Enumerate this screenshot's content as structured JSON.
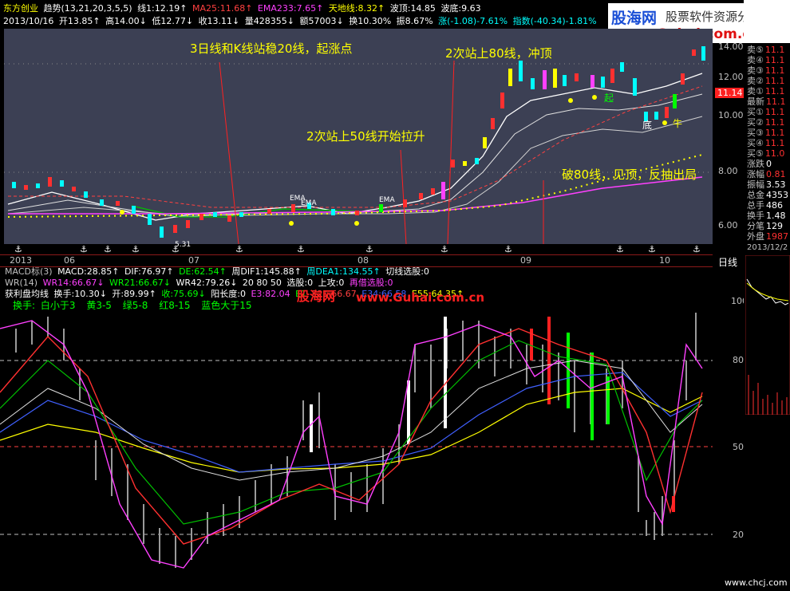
{
  "top_bar": {
    "stock_name": "东方创业",
    "indicator": "趋势(13,21,20,3,5,5)",
    "ma_items": [
      {
        "text": "线1:12.19↑",
        "color": "#ffffff"
      },
      {
        "text": "MA25:11.68↑",
        "color": "#ff4040"
      },
      {
        "text": "EMA233:7.65↑",
        "color": "#ff40ff"
      },
      {
        "text": "天地线:8.32↑",
        "color": "#ffff00"
      },
      {
        "text": "波顶:14.85",
        "color": "#ffffff"
      },
      {
        "text": "波底:9.63",
        "color": "#ffffff"
      }
    ]
  },
  "second_bar": {
    "date": "2013/10/16",
    "items": [
      {
        "text": "开13.85↑",
        "color": "#ffffff"
      },
      {
        "text": "高14.00↓",
        "color": "#ffffff"
      },
      {
        "text": "低12.77↓",
        "color": "#ffffff"
      },
      {
        "text": "收13.11↓",
        "color": "#ffffff"
      },
      {
        "text": "量428355↓",
        "color": "#ffffff"
      },
      {
        "text": "额57003↓",
        "color": "#ffffff"
      },
      {
        "text": "换10.30%",
        "color": "#ffffff"
      },
      {
        "text": "振8.67%",
        "color": "#ffffff"
      },
      {
        "text": "涨(-1.08)-7.61%",
        "color": "#00ffff"
      },
      {
        "text": "指数(-40.34)-1.81%",
        "color": "#00ffff"
      }
    ]
  },
  "logo": {
    "brand": "股海网",
    "tagline": "股票软件资源分享",
    "url": "www.Guhai.com.cn"
  },
  "annotations": [
    {
      "text": "3日线和K线站稳20线，起涨点"
    },
    {
      "text": "2次站上80线，冲顶"
    },
    {
      "text": "2次站上50线开始拉升"
    },
    {
      "text": "破80线，见顶，反抽出局"
    }
  ],
  "chart_labels": {
    "qi": "起",
    "di": "底",
    "niu": "牛",
    "ema1": "EMA",
    "ema2": "EMA",
    "ema3": "EMA",
    "low_mark": "5.31",
    "price_flag": "11.14"
  },
  "price_axis": [
    "14.00",
    "12.00",
    "10.00",
    "8.00",
    "6.00"
  ],
  "date_axis": {
    "year": "2013",
    "months": [
      "06",
      "07",
      "08",
      "09",
      "10"
    ],
    "period": "日线"
  },
  "indicator_rows": {
    "macd": [
      {
        "text": "MACD标(3)",
        "color": "#c0c0c0"
      },
      {
        "text": "MACD:28.85↑",
        "color": "#ffffff"
      },
      {
        "text": "DIF:76.97↑",
        "color": "#ffffff"
      },
      {
        "text": "DE:62.54↑",
        "color": "#00ff00"
      },
      {
        "text": "周DIF1:145.88↑",
        "color": "#ffffff"
      },
      {
        "text": "周DEA1:134.55↑",
        "color": "#00ffff"
      },
      {
        "text": "切线选股:0",
        "color": "#ffffff"
      }
    ],
    "wr": [
      {
        "text": "WR(14)",
        "color": "#c0c0c0"
      },
      {
        "text": "WR14:66.67↓",
        "color": "#ff40ff"
      },
      {
        "text": "WR21:66.67↓",
        "color": "#00ff00"
      },
      {
        "text": "WR42:79.26↓",
        "color": "#ffffff"
      },
      {
        "text": "20 80 50",
        "color": "#ffffff"
      },
      {
        "text": "选股:0",
        "color": "#ffffff"
      },
      {
        "text": "上攻:0",
        "color": "#ffffff"
      },
      {
        "text": "再借选股:0",
        "color": "#ff40ff"
      }
    ],
    "huoli": [
      {
        "text": "获利盘均线",
        "color": "#ffffff"
      },
      {
        "text": "换手:10.30↓",
        "color": "#ffffff"
      },
      {
        "text": "开:89.99↑",
        "color": "#ffffff"
      },
      {
        "text": "收:75.69↓",
        "color": "#00ff00"
      },
      {
        "text": "阳长度:0",
        "color": "#ffffff"
      },
      {
        "text": "E3:82.04",
        "color": "#ff40ff"
      },
      {
        "text": "E1",
        "color": "#00ff00"
      },
      {
        "text": "E21:66.67",
        "color": "#ff4040"
      },
      {
        "text": "E34:66.58",
        "color": "#4060ff"
      },
      {
        "text": "E55:64.35↑",
        "color": "#ffff00"
      }
    ],
    "legend": [
      {
        "text": "换手:",
        "color": "#00ff00"
      },
      {
        "text": "白小于3",
        "color": "#00ff00"
      },
      {
        "text": "黄3-5",
        "color": "#00ff00"
      },
      {
        "text": "绿5-8",
        "color": "#00ff00"
      },
      {
        "text": "红8-15",
        "color": "#00ff00"
      },
      {
        "text": "蓝色大于15",
        "color": "#00ff00"
      }
    ]
  },
  "watermark": {
    "brand": "股海网",
    "url": "www.Guhai.com.cn"
  },
  "lower_axis": [
    "100",
    "80",
    "50",
    "20"
  ],
  "quote_panel": {
    "rows": [
      {
        "label": "卖⑤",
        "value": "11.1"
      },
      {
        "label": "卖④",
        "value": "11.1"
      },
      {
        "label": "卖③",
        "value": "11.1"
      },
      {
        "label": "卖②",
        "value": "11.1"
      },
      {
        "label": "卖①",
        "value": "11.1"
      },
      {
        "label": "最新",
        "value": "11.1"
      },
      {
        "label": "买①",
        "value": "11.1"
      },
      {
        "label": "买②",
        "value": "11.1"
      },
      {
        "label": "买③",
        "value": "11.1"
      },
      {
        "label": "买④",
        "value": "11.1"
      },
      {
        "label": "买⑤",
        "value": "11.0"
      },
      {
        "label": "涨跌",
        "value": "0"
      },
      {
        "label": "涨幅",
        "value": "0.81"
      },
      {
        "label": "振幅",
        "value": "3.53"
      },
      {
        "label": "总金",
        "value": "4353"
      },
      {
        "label": "总手",
        "value": "486"
      },
      {
        "label": "换手",
        "value": "1.48"
      },
      {
        "label": "分笔",
        "value": "129"
      },
      {
        "label": "外盘",
        "value": "1987"
      }
    ],
    "date": "2013/12/2"
  },
  "footer": {
    "site": "www.chcj.com"
  }
}
